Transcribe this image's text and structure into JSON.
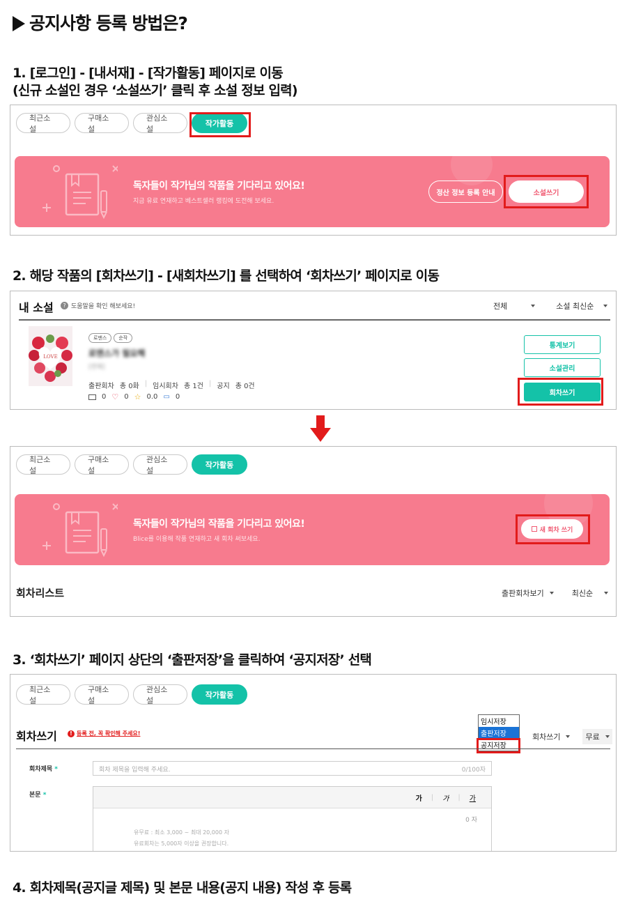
{
  "page_title": "공지사항 등록 방법은?",
  "steps": {
    "s1_line1": "1. [로그인] - [내서재] - [작가활동] 페이지로 이동",
    "s1_line2": "(신규 소설인 경우 ‘소설쓰기’ 클릭 후 소설 정보 입력)",
    "s2": "2. 해당 작품의 [회차쓰기] - [새회차쓰기] 를 선택하여 ‘회차쓰기’ 페이지로 이동",
    "s3": "3. ‘회차쓰기’ 페이지 상단의 ‘출판저장’을 클릭하여 ‘공지저장’ 선택",
    "s4": "4. 회차제목(공지글 제목) 및 본문 내용(공지 내용) 작성 후 등록"
  },
  "tabs": [
    "최근소설",
    "구매소설",
    "관심소설",
    "작가활동"
  ],
  "banner1": {
    "title": "독자들이 작가님의 작품을 기다리고 있어요!",
    "subtitle": "지금 유료 연재하고 베스트셀러 랭킹에 도전해 보세요.",
    "settle_btn": "정산 정보 등록 안내",
    "write_btn": "소설쓰기"
  },
  "mynovel": {
    "title": "내 소설",
    "help": "도움말을 확인 해보세요!",
    "filter_all": "전체",
    "filter_sort": "소설 최신순",
    "tag1": "로맨스",
    "tag2": "순작",
    "novel_name": "로맨스가 필요해",
    "novel_sub": "[연재]",
    "cover_text": "LOVE",
    "stat_pub_label": "출판회차",
    "stat_pub_val": "총 0화",
    "stat_tmp_label": "임시회차",
    "stat_tmp_val": "총 1건",
    "stat_notice_label": "공지",
    "stat_notice_val": "총 0건",
    "views": "0",
    "likes": "0",
    "rating": "0.0",
    "comments": "0",
    "btn_stats": "통계보기",
    "btn_manage": "소설관리",
    "btn_write_ep": "회차쓰기"
  },
  "banner2": {
    "title": "독자들이 작가님의 작품을 기다리고 있어요!",
    "subtitle": "Blice를 이용해 작품 연재하고 새 회차 써보세요.",
    "new_ep_btn": "새 회차 쓰기"
  },
  "episode_list": {
    "title": "회차리스트",
    "filter1": "출판회차보기",
    "filter2": "최신순"
  },
  "write_page": {
    "title": "회차쓰기",
    "warning": "등록 전, 꼭 확인해 주세요!",
    "dropdown_options": [
      "임시저장",
      "출판저장",
      "공지저장"
    ],
    "sel1": "회차쓰기",
    "sel2": "무료",
    "field_title_label": "회차제목",
    "field_title_placeholder": "회차 제목을 입력해 주세요.",
    "field_title_count": "0/100자",
    "field_body_label": "본문",
    "toolbar_b": "가",
    "toolbar_i": "가",
    "toolbar_u": "가",
    "body_count": "0 자",
    "hint1": "유무료 : 최소 3,000 ~ 최대 20,000 자",
    "hint2": "유료회차는 5,000자 이상을 권장합니다.",
    "required_mark": "*"
  },
  "colors": {
    "accent": "#14c2a8",
    "banner": "#f77b8e",
    "highlight": "#e21b1b"
  }
}
